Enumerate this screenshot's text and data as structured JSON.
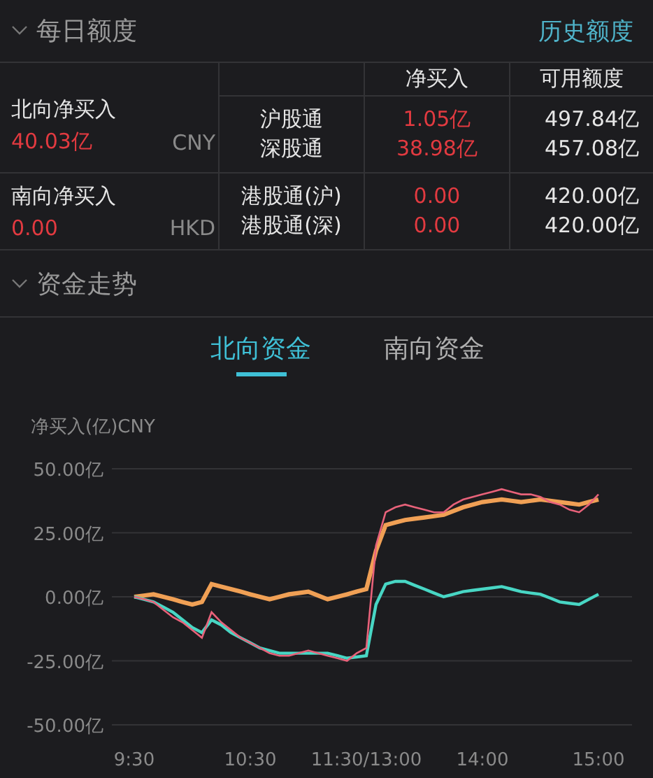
{
  "header": {
    "title": "每日额度",
    "link": "历史额度"
  },
  "quota_table": {
    "columns": [
      "净买入",
      "可用额度"
    ],
    "groups": [
      {
        "label": "北向净买入",
        "value": "40.03亿",
        "currency": "CNY",
        "channels": [
          {
            "name": "沪股通",
            "net_buy": "1.05亿",
            "available": "497.84亿"
          },
          {
            "name": "深股通",
            "net_buy": "38.98亿",
            "available": "457.08亿"
          }
        ]
      },
      {
        "label": "南向净买入",
        "value": "0.00",
        "currency": "HKD",
        "channels": [
          {
            "name": "港股通(沪)",
            "net_buy": "0.00",
            "available": "420.00亿"
          },
          {
            "name": "港股通(深)",
            "net_buy": "0.00",
            "available": "420.00亿"
          }
        ]
      }
    ]
  },
  "trend": {
    "title": "资金走势",
    "tabs": [
      {
        "label": "北向资金",
        "selected": true
      },
      {
        "label": "南向资金",
        "selected": false
      }
    ],
    "chart_data": {
      "type": "line",
      "ylabel": "净买入(亿)CNY",
      "categories": [
        "9:30",
        null,
        null,
        null,
        null,
        null,
        null,
        null,
        null,
        null,
        null,
        null,
        "10:30",
        null,
        null,
        null,
        null,
        null,
        null,
        null,
        null,
        null,
        null,
        null,
        "11:30/13:00",
        null,
        null,
        null,
        null,
        null,
        null,
        null,
        null,
        null,
        null,
        null,
        "14:00",
        null,
        null,
        null,
        null,
        null,
        null,
        null,
        null,
        null,
        null,
        null,
        "15:00"
      ],
      "ylim": [
        -50,
        50
      ],
      "grid": true,
      "yticks": [
        {
          "value": 50,
          "label": "50.00亿"
        },
        {
          "value": 25,
          "label": "25.00亿"
        },
        {
          "value": 0,
          "label": "0.00亿"
        },
        {
          "value": -25,
          "label": "-25.00亿"
        },
        {
          "value": -50,
          "label": "-50.00亿"
        }
      ],
      "series": [
        {
          "color": "#f0a055",
          "values": [
            0,
            0.5,
            1,
            0,
            -1,
            -2,
            -3,
            -2,
            5,
            4,
            3,
            2,
            1,
            0,
            -1,
            0,
            1,
            1.5,
            2,
            0.5,
            -1,
            0,
            1,
            2,
            3,
            18,
            28,
            29,
            30,
            30.5,
            31,
            31.5,
            32,
            33.5,
            35,
            36,
            37,
            37.5,
            38,
            37.5,
            37,
            37.5,
            38,
            37.5,
            37,
            36.5,
            36,
            37,
            38
          ]
        },
        {
          "color": "#48d6c4",
          "values": [
            0,
            -1,
            -2,
            -4,
            -6,
            -9,
            -12,
            -14,
            -9,
            -11,
            -14,
            -16,
            -18,
            -20,
            -21,
            -22,
            -22,
            -22,
            -22,
            -22,
            -22,
            -23,
            -24,
            -23.5,
            -23,
            -3,
            5,
            6,
            6,
            4.5,
            3,
            1.5,
            0,
            1,
            2,
            2.5,
            3,
            3.5,
            4,
            3,
            2,
            1.5,
            1,
            -0.5,
            -2,
            -2.5,
            -3,
            -1,
            1
          ]
        },
        {
          "color": "#e8627a",
          "values": [
            0,
            -1,
            -2,
            -5,
            -8,
            -10,
            -13,
            -16,
            -6,
            -10,
            -13,
            -16,
            -18,
            -20,
            -22,
            -23,
            -23,
            -22,
            -21,
            -22,
            -23,
            -24,
            -25,
            -22,
            -20,
            20,
            33,
            35,
            36,
            35,
            34,
            33,
            33,
            36,
            38,
            39,
            40,
            41,
            42,
            41,
            40,
            40,
            39,
            37,
            36,
            34,
            33,
            36,
            40
          ]
        }
      ]
    }
  }
}
